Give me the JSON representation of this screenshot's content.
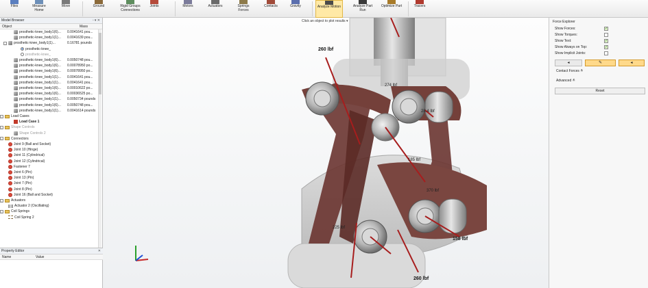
{
  "toolbar": {
    "tools": [
      {
        "label": "Files",
        "label2": "",
        "icon": "files-icon"
      },
      {
        "label": "Measure",
        "label2": "Home",
        "icon": "measure-icon"
      },
      {
        "label": "Move",
        "label2": "",
        "icon": "move-icon"
      },
      {
        "label": "Ground",
        "label2": "",
        "icon": "ground-icon"
      },
      {
        "label": "Rigid Groups",
        "label2": "Connections",
        "icon": "rigid-groups-icon"
      },
      {
        "label": "Joints",
        "label2": "",
        "icon": "joints-icon"
      },
      {
        "label": "Motors",
        "label2": "",
        "icon": "motors-icon"
      },
      {
        "label": "Actuators",
        "label2": "",
        "icon": "actuators-icon"
      },
      {
        "label": "Springs",
        "label2": "Forces",
        "icon": "springs-icon"
      },
      {
        "label": "Contacts",
        "label2": "",
        "icon": "contacts-icon"
      },
      {
        "label": "Gravity",
        "label2": "",
        "icon": "gravity-icon"
      },
      {
        "label": "Analyze Motion",
        "label2": "",
        "icon": "analyze-motion-icon"
      },
      {
        "label": "Analyze Part",
        "label2": "Run",
        "icon": "analyze-part-icon"
      },
      {
        "label": "Optimize Part",
        "label2": "",
        "icon": "optimize-part-icon"
      },
      {
        "label": "Tracers",
        "label2": "",
        "icon": "tracers-icon"
      }
    ]
  },
  "model_browser": {
    "title": "Model Browser",
    "col_object": "Object",
    "col_mass": "Mass",
    "rows": [
      {
        "text": "prosthetic-knee_body1(6)...",
        "mass": "0.0041641 pou...",
        "type": "part",
        "indent": 20
      },
      {
        "text": "prosthetic-knee_body1(1)...",
        "mass": "0.0041639 pou...",
        "type": "part",
        "indent": 20
      },
      {
        "text": "prosthetic-knee_body1(1)...",
        "mass": "0.16781 pounds",
        "type": "part",
        "indent": 12,
        "exp": "-"
      },
      {
        "text": "prosthetic-knee_",
        "mass": "",
        "type": "radio-on",
        "indent": 30
      },
      {
        "text": "prosthetic-knee_",
        "mass": "",
        "type": "radio",
        "indent": 30,
        "muted": true
      },
      {
        "text": "prosthetic-knee_body1(6)...",
        "mass": "0.0050748 pou...",
        "type": "part",
        "indent": 20
      },
      {
        "text": "prosthetic-knee_body1(6)...",
        "mass": "0.00078950 po...",
        "type": "part",
        "indent": 20
      },
      {
        "text": "prosthetic-knee_body1(6)...",
        "mass": "0.00078950 po...",
        "type": "part",
        "indent": 20
      },
      {
        "text": "prosthetic-knee_body1(1)...",
        "mass": "0.0041641 pou...",
        "type": "part",
        "indent": 20
      },
      {
        "text": "prosthetic-knee_body1(1)...",
        "mass": "0.0041641 pou...",
        "type": "part",
        "indent": 20
      },
      {
        "text": "prosthetic-knee_body1(6)...",
        "mass": "0.00010622 po...",
        "type": "part",
        "indent": 20
      },
      {
        "text": "prosthetic-knee_body1(6)...",
        "mass": "0.00036525 po...",
        "type": "part",
        "indent": 20
      },
      {
        "text": "prosthetic-knee_body1(1)...",
        "mass": "0.0050734 pounds",
        "type": "part",
        "indent": 20
      },
      {
        "text": "prosthetic-knee_body1(6)...",
        "mass": "0.0050748 pou...",
        "type": "part",
        "indent": 20
      },
      {
        "text": "prosthetic-knee_body1(1)...",
        "mass": "0.0041614 pounds",
        "type": "part",
        "indent": 20
      },
      {
        "text": "Load Cases",
        "mass": "",
        "type": "folder",
        "indent": 4,
        "exp": "-"
      },
      {
        "text": "Load Case 1",
        "mass": "",
        "type": "load",
        "indent": 20,
        "bold": true
      },
      {
        "text": "Shape Controls",
        "mass": "",
        "type": "folder",
        "indent": 4,
        "exp": "-",
        "muted": true
      },
      {
        "text": "Shape Controls 2",
        "mass": "",
        "type": "part",
        "indent": 20,
        "muted": true
      },
      {
        "text": "Connectors",
        "mass": "",
        "type": "folder",
        "indent": 4,
        "exp": "-"
      },
      {
        "text": "Joint 9 (Ball and Socket)",
        "mass": "",
        "type": "joint",
        "indent": 12
      },
      {
        "text": "Joint 10 (Hinge)",
        "mass": "",
        "type": "joint",
        "indent": 12
      },
      {
        "text": "Joint 11 (Cylindrical)",
        "mass": "",
        "type": "joint",
        "indent": 12
      },
      {
        "text": "Joint 12 (Cylindrical)",
        "mass": "",
        "type": "joint",
        "indent": 12
      },
      {
        "text": "Fastener 7",
        "mass": "",
        "type": "joint",
        "indent": 12
      },
      {
        "text": "Joint 6 (Pin)",
        "mass": "",
        "type": "joint",
        "indent": 12
      },
      {
        "text": "Joint 13 (Pin)",
        "mass": "",
        "type": "joint",
        "indent": 12
      },
      {
        "text": "Joint 7 (Pin)",
        "mass": "",
        "type": "joint",
        "indent": 12
      },
      {
        "text": "Joint 8 (Pin)",
        "mass": "",
        "type": "joint",
        "indent": 12
      },
      {
        "text": "Joint 16 (Ball and Socket)",
        "mass": "",
        "type": "joint",
        "indent": 12
      },
      {
        "text": "Actuators",
        "mass": "",
        "type": "folder",
        "indent": 4,
        "exp": "-"
      },
      {
        "text": "Actuator 2 (Oscillating)",
        "mass": "",
        "type": "actuator",
        "indent": 12
      },
      {
        "text": "Coil Springs",
        "mass": "",
        "type": "folder",
        "indent": 4,
        "exp": "-"
      },
      {
        "text": "Coil Spring 2",
        "mass": "",
        "type": "spring",
        "indent": 12
      }
    ]
  },
  "property_editor": {
    "title": "Property Editor",
    "col_name": "Name",
    "col_value": "Value"
  },
  "viewport": {
    "hint": "Click an object to plot results",
    "forces": [
      {
        "text": "260 lbf",
        "style": "big"
      },
      {
        "text": "274 lbf",
        "style": "sm"
      },
      {
        "text": "28.4 lbf",
        "style": "sm"
      },
      {
        "text": "185 lbf",
        "style": "sm"
      },
      {
        "text": "370 lbf",
        "style": "sm"
      },
      {
        "text": "225 lbf",
        "style": "sm"
      },
      {
        "text": "158 lbf",
        "style": "big"
      },
      {
        "text": "260 lbf",
        "style": "big"
      }
    ]
  },
  "force_explorer": {
    "title": "Force Explorer",
    "options": [
      {
        "label": "Show Forces:",
        "checked": true
      },
      {
        "label": "Show Torques:",
        "checked": false
      },
      {
        "label": "Show Text:",
        "checked": true
      },
      {
        "label": "Show Always on Top:",
        "checked": true
      },
      {
        "label": "Show Implicit Joints:",
        "checked": false
      }
    ],
    "contact_forces": "Contact Forces",
    "advanced": "Advanced",
    "reset": "Reset"
  }
}
